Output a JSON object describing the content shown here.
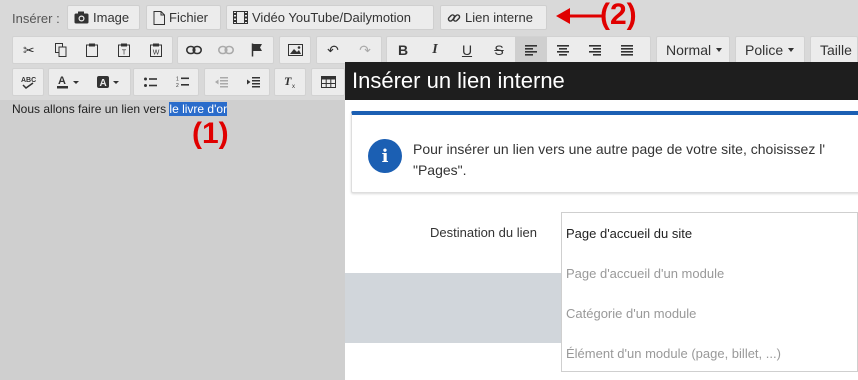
{
  "insert_bar": {
    "label": "Insérer :",
    "image_label": "Image",
    "file_label": "Fichier",
    "video_label": "Vidéo YouTube/Dailymotion",
    "internal_link_label": "Lien interne"
  },
  "annotations": {
    "one": "(1)",
    "two": "(2)",
    "color": "#e00000"
  },
  "toolbar": {
    "format_label": "Normal",
    "font_label": "Police",
    "size_label": "Taille"
  },
  "editor": {
    "text_before": "Nous allons faire un lien vers ",
    "text_selected": "le livre d'or"
  },
  "modal": {
    "title": "Insérer un lien interne",
    "info_text": "Pour insérer un lien vers une autre page de votre site, choisissez l'\n\"Pages\".",
    "destination_label": "Destination du lien",
    "options": [
      "Page d'accueil du site",
      "Page d'accueil d'un module",
      "Catégorie d'un module",
      "Élément d'un module (page, billet, ...)"
    ]
  },
  "colors": {
    "accent": "#1b5fb3",
    "selection": "#2a6ccb",
    "modal_header": "#1e1e1e"
  }
}
